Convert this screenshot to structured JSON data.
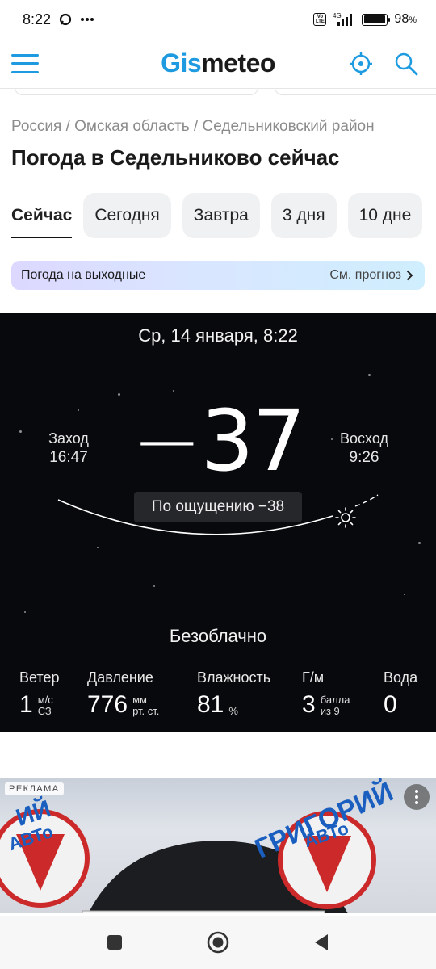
{
  "status_bar": {
    "time": "8:22",
    "network": "4G",
    "battery": "98",
    "battery_suffix": "%",
    "battery_level": 0.98
  },
  "header": {
    "logo_gis": "Gis",
    "logo_meteo": "meteo"
  },
  "breadcrumb": "Россия / Омская область / Седельниковский район",
  "page_title": "Погода в Седельниково сейчас",
  "tabs": [
    {
      "label": "Сейчас",
      "active": true
    },
    {
      "label": "Сегодня"
    },
    {
      "label": "Завтра"
    },
    {
      "label": "3 дня"
    },
    {
      "label": "10 дне"
    }
  ],
  "promo": {
    "title": "Погода на выходные",
    "link": "См. прогноз"
  },
  "weather": {
    "datetime": "Ср, 14 января, 8:22",
    "temperature": "37",
    "temperature_sign": "−",
    "sunset_label": "Заход",
    "sunset_time": "16:47",
    "sunrise_label": "Восход",
    "sunrise_time": "9:26",
    "feels_like": "По ощущению −38",
    "condition": "Безоблачно",
    "params": {
      "wind": {
        "label": "Ветер",
        "value": "1",
        "unit_top": "м/с",
        "unit_bottom": "СЗ"
      },
      "pressure": {
        "label": "Давление",
        "value": "776",
        "unit_top": "мм",
        "unit_bottom": "рт. ст."
      },
      "humidity": {
        "label": "Влажность",
        "value": "81",
        "unit": "%"
      },
      "geomagnetic": {
        "label": "Г/м",
        "value": "3",
        "unit_top": "балла",
        "unit_bottom": "из 9"
      },
      "water": {
        "label": "Вода",
        "value": "0"
      }
    }
  },
  "ad": {
    "tag": "РЕКЛАМА",
    "text_left": "ИЙ",
    "text_right": "ГРИГОРИЙ",
    "brand_left": "АВТо",
    "brand_right": "АВТо"
  }
}
